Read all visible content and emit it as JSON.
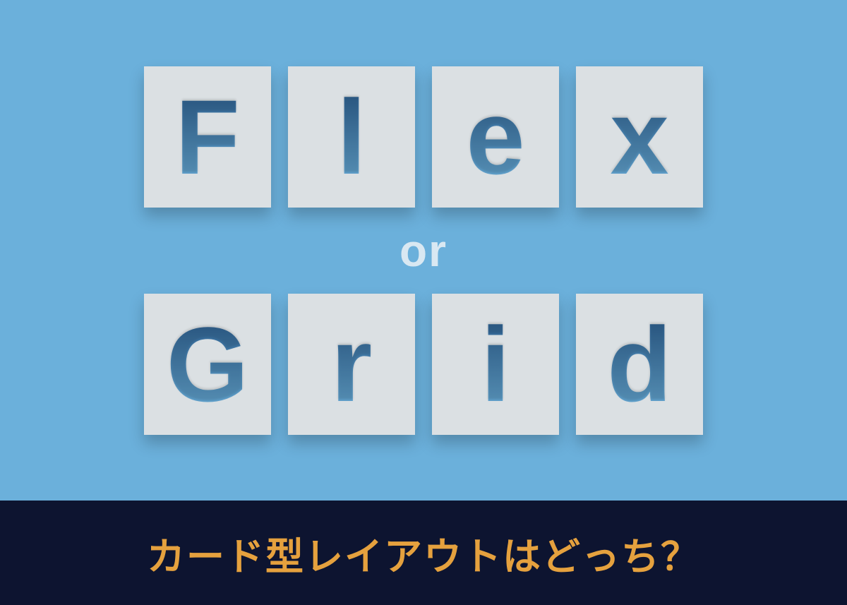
{
  "hero": {
    "top_row": [
      "F",
      "l",
      "e",
      "x"
    ],
    "middle_text": "or",
    "bottom_row": [
      "G",
      "r",
      "i",
      "d"
    ]
  },
  "footer": {
    "text": "カード型レイアウトはどっち？"
  },
  "colors": {
    "hero_bg": "#6bb0db",
    "card_bg": "#dbe0e3",
    "footer_bg": "#0d1430",
    "footer_text": "#e5a13e"
  }
}
